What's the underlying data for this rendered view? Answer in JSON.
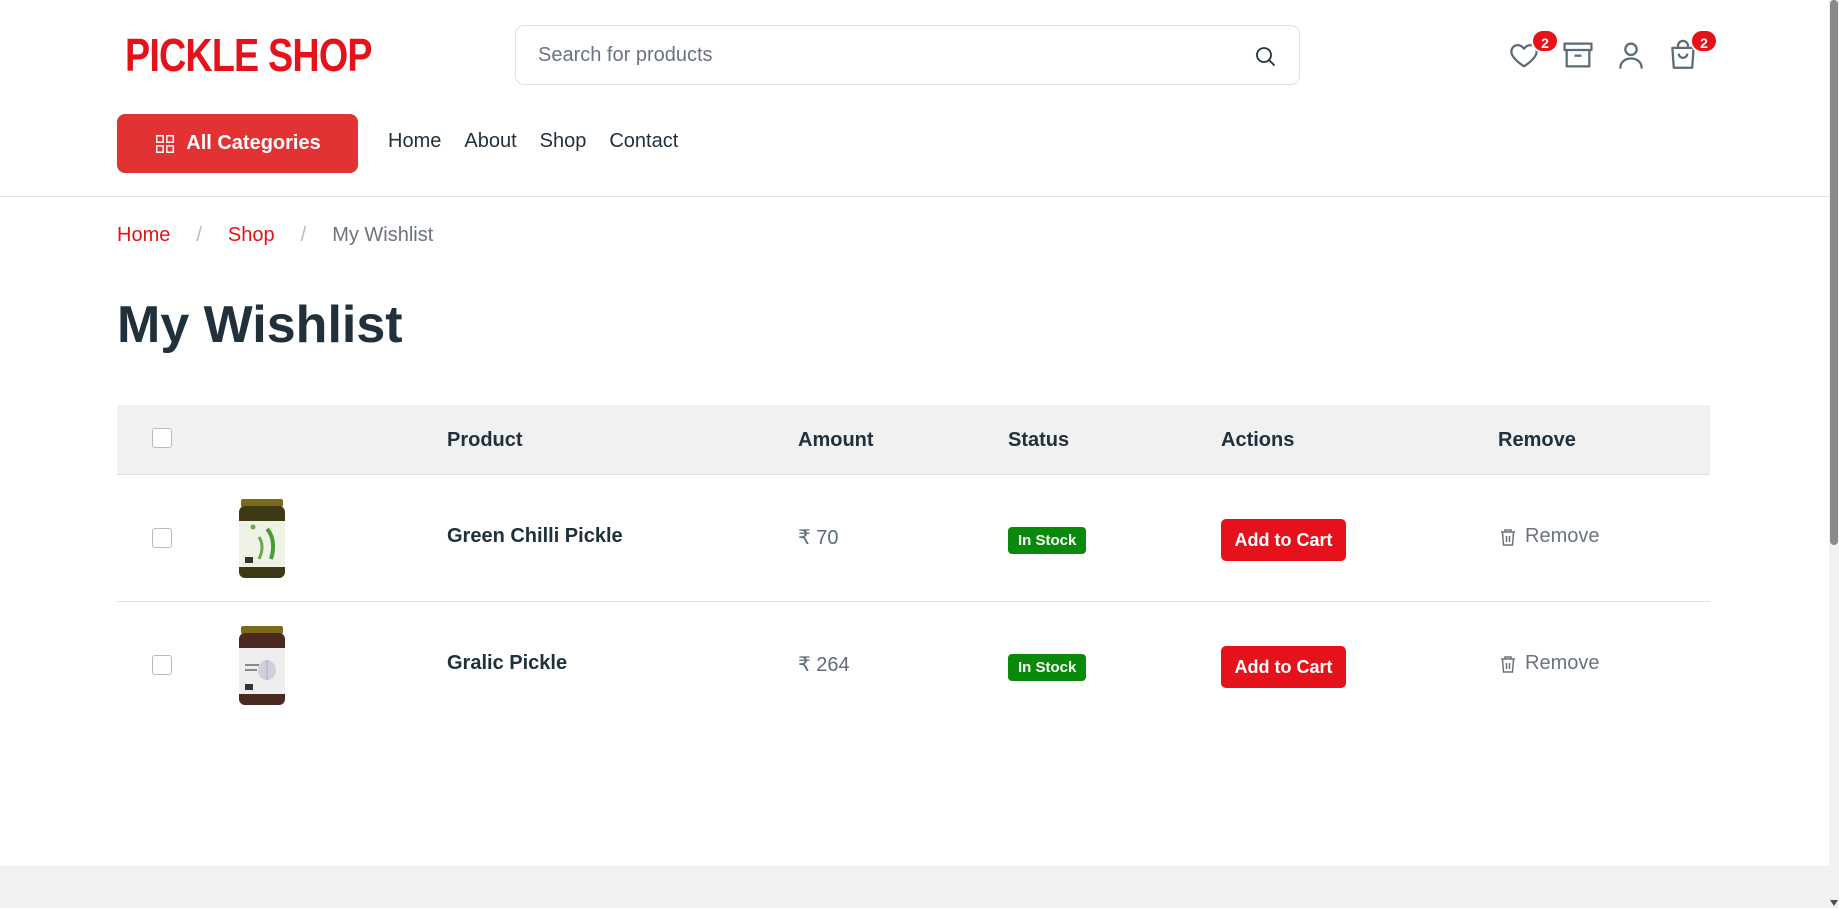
{
  "header": {
    "logo": "PICKLE SHOP",
    "search_placeholder": "Search for products",
    "wishlist_count": "2",
    "cart_count": "2",
    "all_categories": "All Categories",
    "nav": [
      "Home",
      "About",
      "Shop",
      "Contact"
    ]
  },
  "breadcrumb": {
    "home": "Home",
    "shop": "Shop",
    "current": "My Wishlist",
    "separator": "/"
  },
  "page": {
    "title": "My Wishlist"
  },
  "table": {
    "headers": {
      "product": "Product",
      "amount": "Amount",
      "status": "Status",
      "actions": "Actions",
      "remove": "Remove"
    },
    "rows": [
      {
        "name": "Green Chilli Pickle",
        "amount": "₹ 70",
        "status": "In Stock",
        "action": "Add to Cart",
        "remove": "Remove"
      },
      {
        "name": "Gralic Pickle",
        "amount": "₹ 264",
        "status": "In Stock",
        "action": "Add to Cart",
        "remove": "Remove"
      }
    ]
  },
  "colors": {
    "brand": "#e5121b",
    "status_green": "#0a8a0a",
    "header_bg": "#f0f2f2"
  },
  "icons": [
    "search-icon",
    "heart-icon",
    "archive-icon",
    "user-icon",
    "shopping-bag-icon",
    "grid-icon",
    "trash-icon"
  ]
}
